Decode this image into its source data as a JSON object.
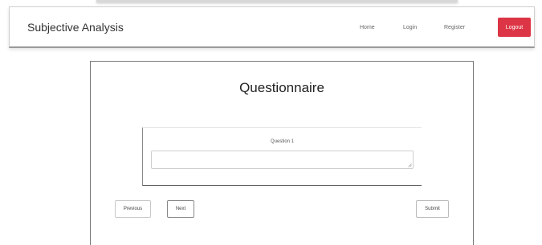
{
  "navbar": {
    "brand": "Subjective Analysis",
    "links": {
      "home": "Home",
      "login": "Login",
      "register": "Register"
    },
    "logout_label": "Logout",
    "logout_color": "#dc3545"
  },
  "main": {
    "title": "Questionnaire",
    "question": {
      "label": "Question 1",
      "answer_value": "",
      "answer_placeholder": ""
    },
    "buttons": {
      "previous": "Previous",
      "next": "Next",
      "submit": "Submit"
    }
  }
}
